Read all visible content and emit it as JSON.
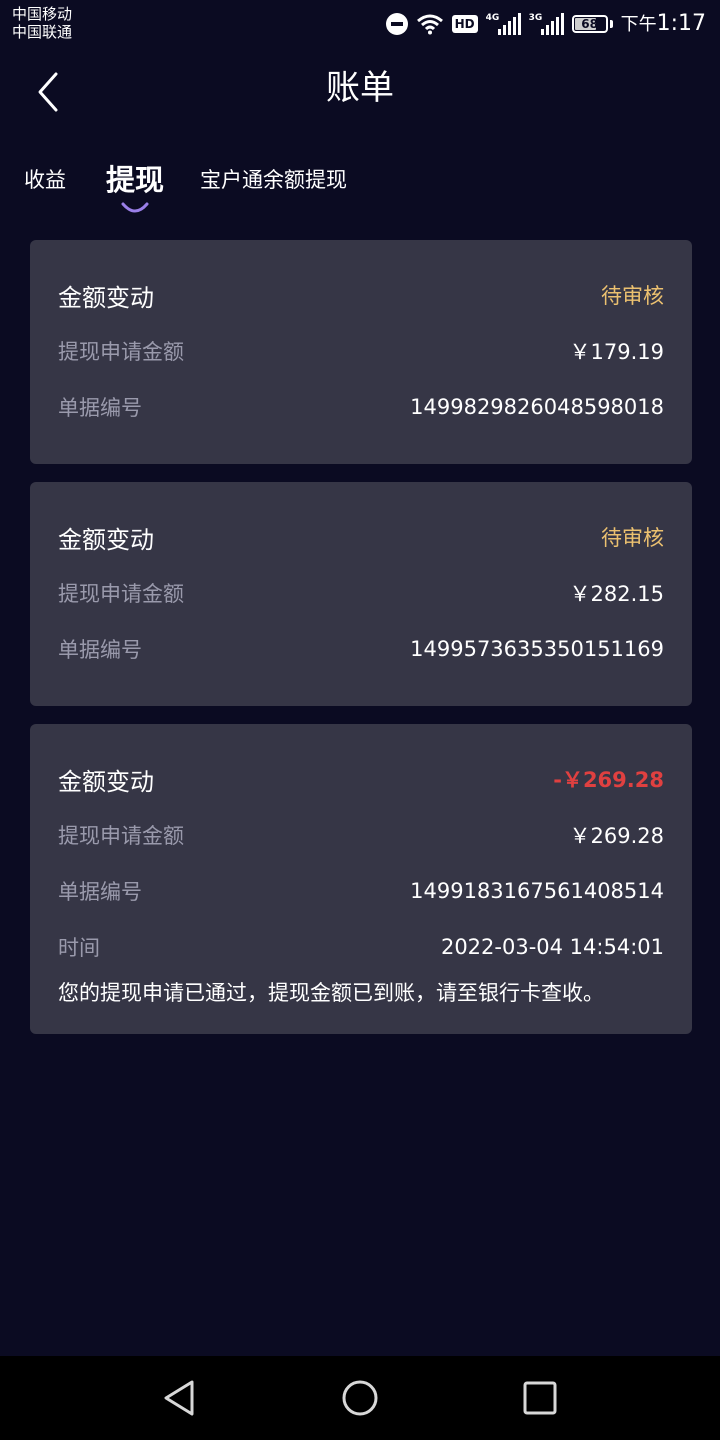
{
  "status_bar": {
    "carrier_1": "中国移动",
    "carrier_2": "中国联通",
    "hd": "HD",
    "sim1_network": "4G",
    "sim2_network": "3G",
    "battery": "68",
    "ampm": "下午",
    "time": "1:17"
  },
  "header": {
    "title": "账单",
    "back_icon": "chevron-left-icon"
  },
  "tabs": [
    {
      "label": "收益",
      "active": false
    },
    {
      "label": "提现",
      "active": true
    },
    {
      "label": "宝户通余额提现",
      "active": false
    }
  ],
  "records": [
    {
      "title": "金额变动",
      "status": "待审核",
      "amount_label": "提现申请金额",
      "amount": "￥179.19",
      "order_label": "单据编号",
      "order_no": "1499829826048598018"
    },
    {
      "title": "金额变动",
      "status": "待审核",
      "amount_label": "提现申请金额",
      "amount": "￥282.15",
      "order_label": "单据编号",
      "order_no": "1499573635350151169"
    },
    {
      "title": "金额变动",
      "status": "-￥269.28",
      "amount_label": "提现申请金额",
      "amount": "￥269.28",
      "order_label": "单据编号",
      "order_no": "1499183167561408514",
      "time_label": "时间",
      "time": "2022-03-04 14:54:01",
      "note": "您的提现申请已通过，提现金额已到账，请至银行卡查收。"
    }
  ],
  "colors": {
    "background": "#0b0b22",
    "card": "#363646",
    "pending": "#ecc170",
    "debit": "#e04040",
    "label": "#9a9aac",
    "tab_indicator": "#9a7fe8"
  },
  "nav_bar": {
    "back": "triangle-back-icon",
    "home": "circle-home-icon",
    "recent": "square-recent-icon"
  }
}
